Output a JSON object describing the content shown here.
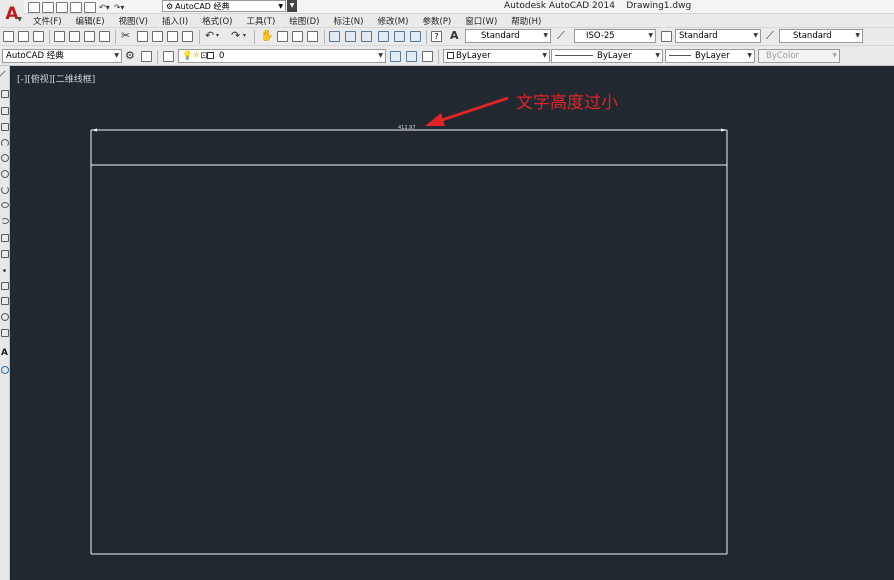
{
  "window": {
    "title": "Autodesk AutoCAD 2014    Drawing1.dwg",
    "workspace_combo": "AutoCAD 经典"
  },
  "menu": [
    "文件(F)",
    "编辑(E)",
    "视图(V)",
    "插入(I)",
    "格式(O)",
    "工具(T)",
    "绘图(D)",
    "标注(N)",
    "修改(M)",
    "参数(P)",
    "窗口(W)",
    "帮助(H)"
  ],
  "styles_toolbar": {
    "text_style": "Standard",
    "dim_style": "ISO-25",
    "table_style": "Standard",
    "mleader_style": "Standard"
  },
  "props_toolbar": {
    "workspace": "AutoCAD 经典",
    "layer": "0",
    "color": "ByLayer",
    "linetype": "ByLayer",
    "lineweight": "ByLayer",
    "plotstyle": "ByColor"
  },
  "viewport": {
    "label": "[-][俯视][二维线框]"
  },
  "drawing": {
    "dimension_value": "412.97",
    "annotation": "文字高度过小",
    "annotation_color": "#e02427",
    "background_color": "#212830",
    "line_color": "#f2f2f2"
  },
  "icons": {
    "app": "autocad-logo-icon",
    "left_toolbar": [
      "line-icon",
      "polyline-icon",
      "polygon-icon",
      "rectangle-icon",
      "arc-icon",
      "circle-icon",
      "revcloud-icon",
      "spline-icon",
      "ellipse-icon",
      "ellipse-arc-icon",
      "insert-block-icon",
      "make-block-icon",
      "point-icon",
      "hatch-icon",
      "gradient-icon",
      "region-icon",
      "table-icon",
      "mtext-icon",
      "add-selected-icon"
    ]
  }
}
